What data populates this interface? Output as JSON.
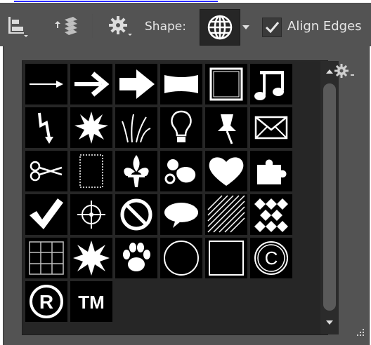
{
  "toolbar": {
    "shape_label": "Shape:",
    "align_edges_label": "Align Edges",
    "align_edges_checked": true
  },
  "icons": {
    "align": "align-icon",
    "arrange": "arrange-layers-icon",
    "settings": "gear-icon",
    "shape_preview": "globe-icon",
    "panel_menu": "gear-icon",
    "resize": "resize-grip-icon"
  },
  "shapes": [
    [
      "arrow-thin",
      "arrow-medium",
      "arrow-bold",
      "banner",
      "frame-square",
      "music-note"
    ],
    [
      "lightning",
      "starburst",
      "grass",
      "lightbulb",
      "pushpin",
      "envelope"
    ],
    [
      "scissors",
      "stamp",
      "fleur-de-lis",
      "ornament",
      "heart",
      "puzzle"
    ],
    [
      "checkmark",
      "crosshair",
      "no-sign",
      "speech-bubble",
      "diagonal-lines",
      "checkerboard"
    ],
    [
      "grid",
      "starburst-bold",
      "paw-print",
      "circle-frame",
      "square-frame",
      "copyright"
    ],
    [
      "registered",
      "trademark"
    ]
  ],
  "glyphs": {
    "registered": "R",
    "trademark": "TM",
    "copyright": "C"
  },
  "colors": {
    "panel_bg": "#535353",
    "tile_bg": "#000000",
    "glyph": "#ffffff"
  }
}
